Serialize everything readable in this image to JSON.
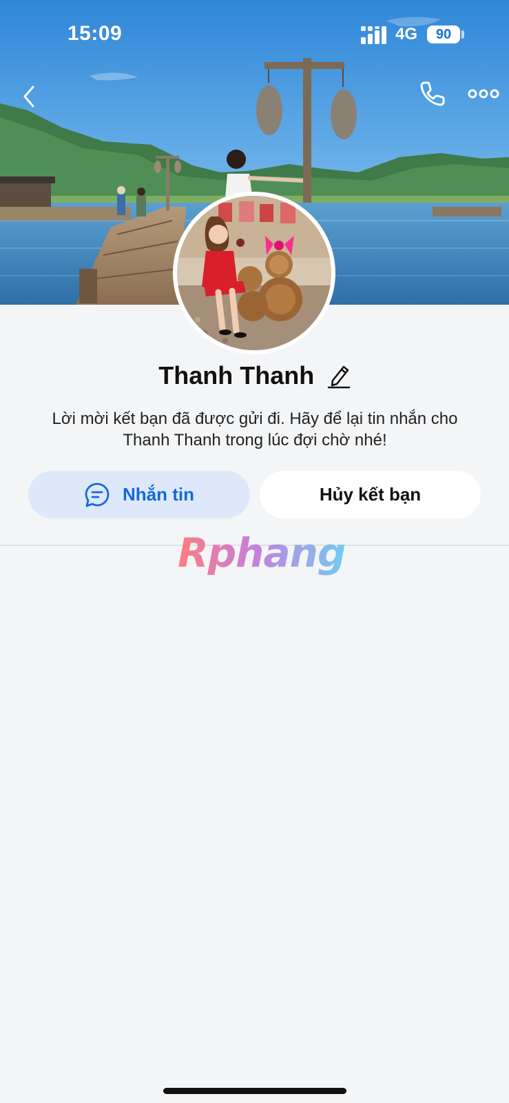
{
  "status_bar": {
    "time": "15:09",
    "network": "4G",
    "battery": "90"
  },
  "nav": {
    "back_icon": "chevron-left-icon",
    "call_icon": "phone-icon",
    "more_icon": "more-dots-icon"
  },
  "profile": {
    "name": "Thanh Thanh",
    "edit_icon": "pencil-icon",
    "invite_message": "Lời mời kết bạn đã được gửi đi. Hãy để lại tin nhắn cho Thanh Thanh trong lúc đợi chờ nhé!"
  },
  "actions": {
    "message_label": "Nhắn tin",
    "message_icon": "chat-bubble-icon",
    "unfriend_label": "Hủy kết bạn"
  },
  "watermark": "Rphang",
  "colors": {
    "accent": "#1468dc",
    "message_button_bg": "#dde9fb",
    "background": "#f4f5f7"
  }
}
